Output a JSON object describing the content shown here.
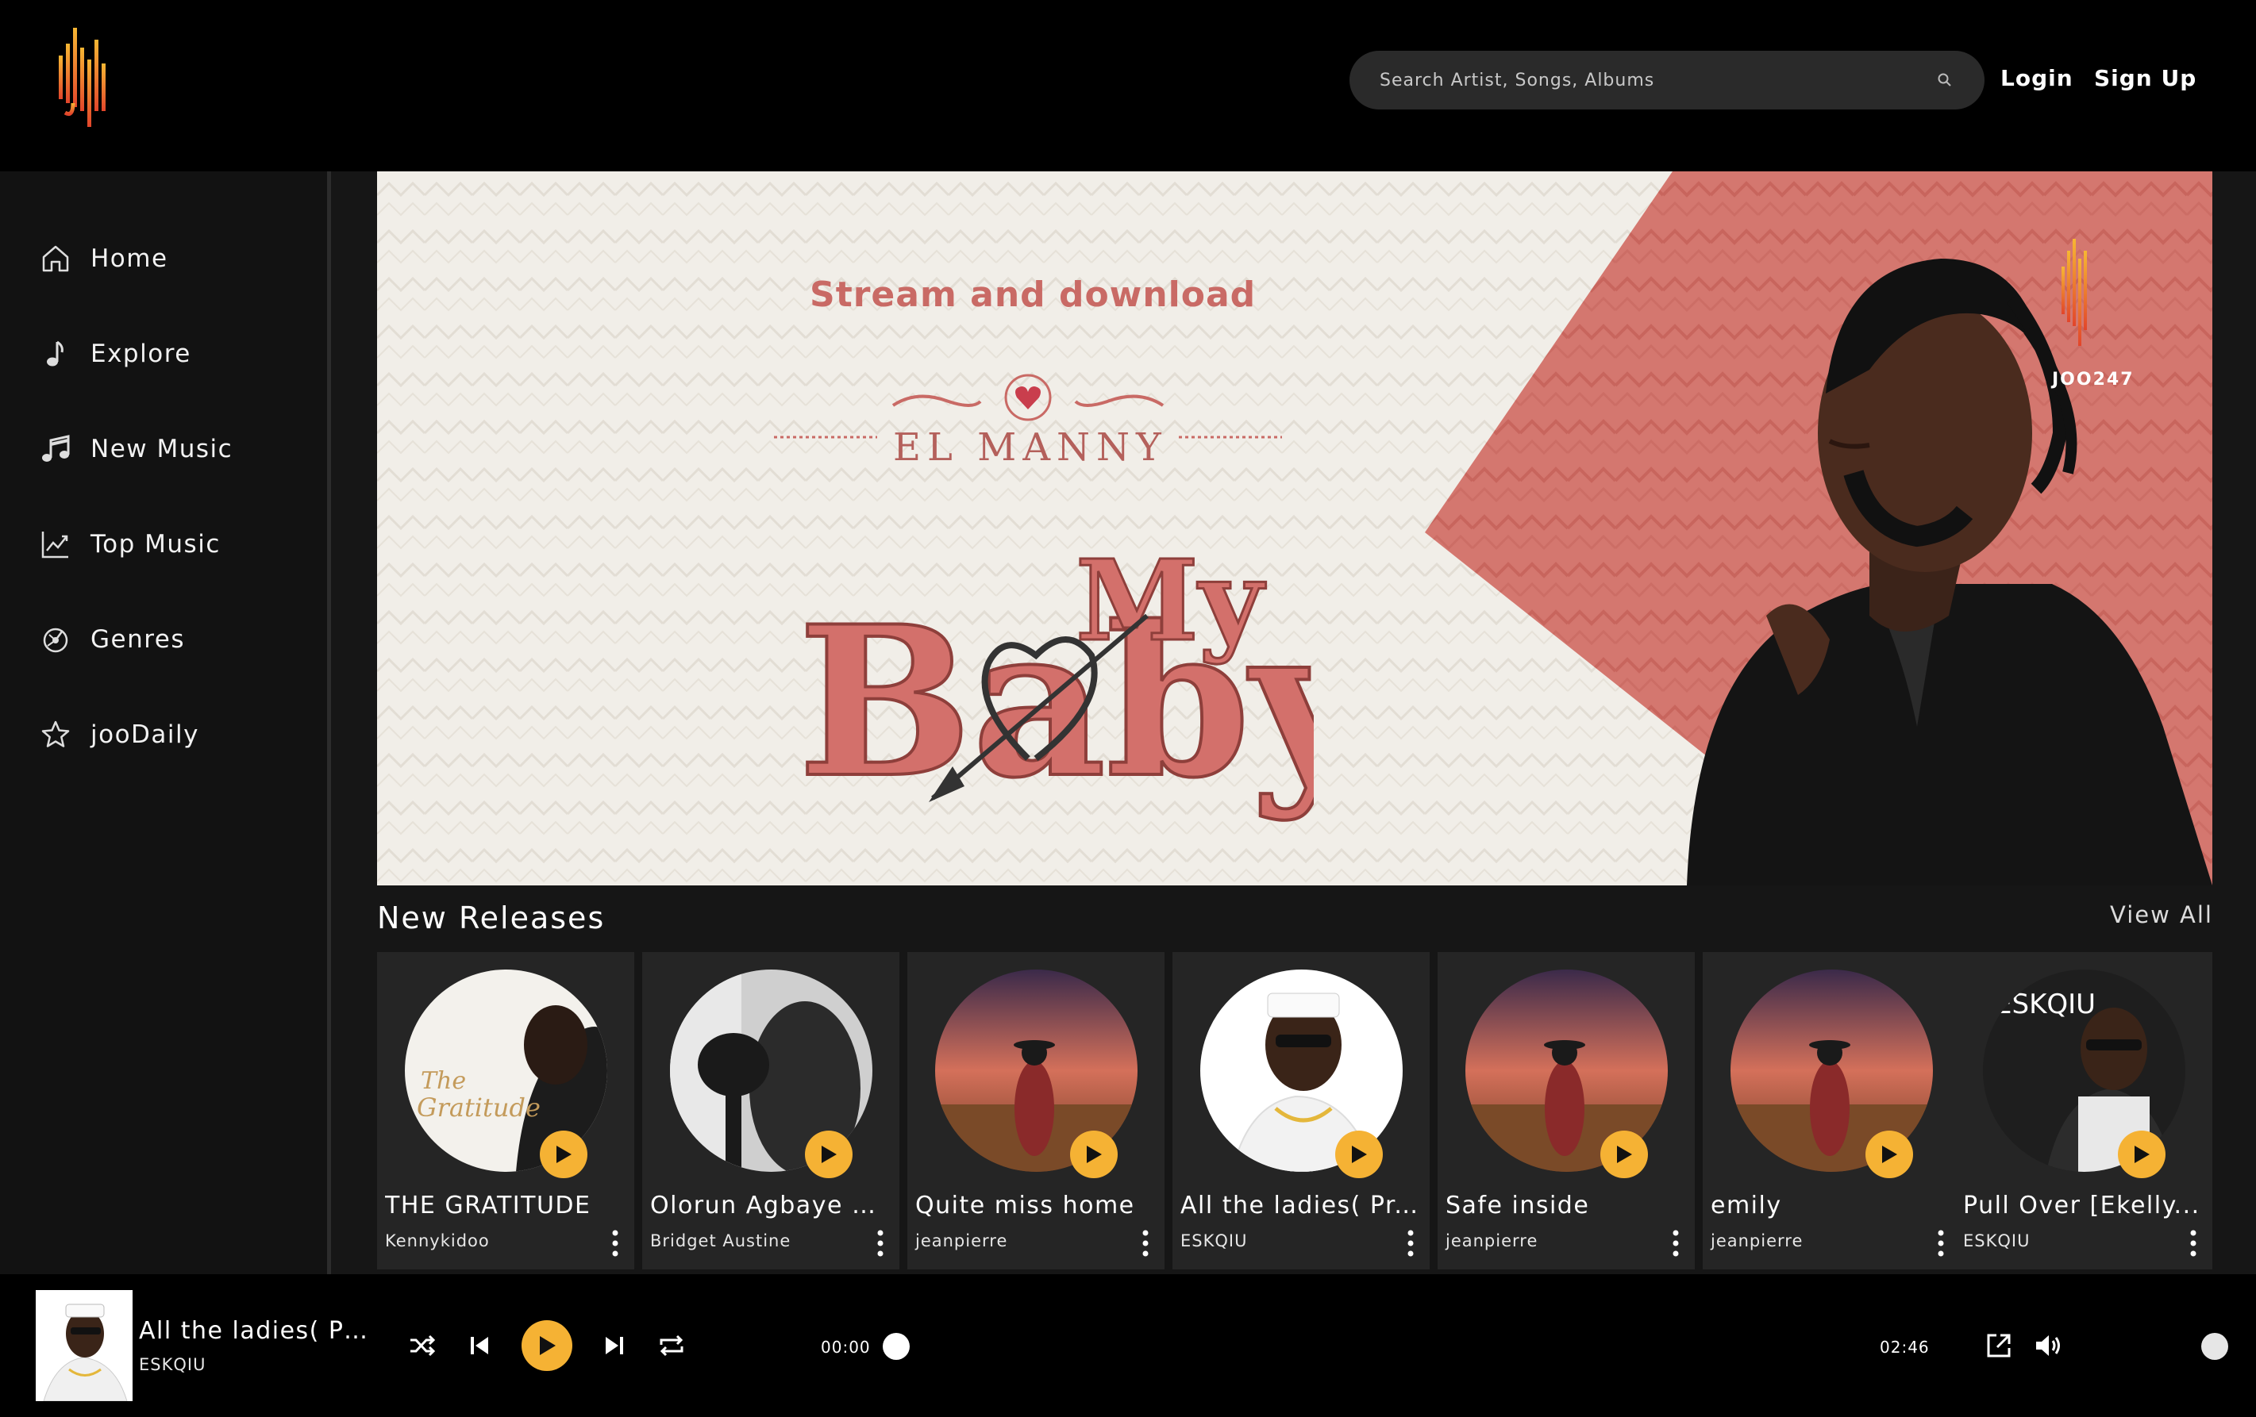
{
  "header": {
    "search_placeholder": "Search Artist, Songs, Albums",
    "login_label": "Login",
    "signup_label": "Sign Up"
  },
  "sidebar": {
    "items": [
      {
        "label": "Home",
        "icon": "home-icon"
      },
      {
        "label": "Explore",
        "icon": "music-note-icon"
      },
      {
        "label": "New Music",
        "icon": "music-notes-icon"
      },
      {
        "label": "Top Music",
        "icon": "trending-chart-icon"
      },
      {
        "label": "Genres",
        "icon": "genres-icon"
      },
      {
        "label": "jooDaily",
        "icon": "star-icon"
      }
    ]
  },
  "banner": {
    "stream_text": "Stream  and download",
    "artist_name": "EL MANNY",
    "song_title": "My Baby",
    "brand": "JOO247"
  },
  "new_releases": {
    "title": "New Releases",
    "view_all_label": "View All",
    "items": [
      {
        "title": "THE GRATITUDE",
        "artist": "Kennykidoo"
      },
      {
        "title": "Olorun Agbaye C...",
        "artist": "Bridget Austine"
      },
      {
        "title": "Quite miss home",
        "artist": "jeanpierre"
      },
      {
        "title": "All the ladies( Pr...",
        "artist": "ESKQIU"
      },
      {
        "title": "Safe inside",
        "artist": "jeanpierre"
      },
      {
        "title": "emily",
        "artist": "jeanpierre"
      },
      {
        "title": "Pull Over [Ekelly...",
        "artist": "ESKQIU"
      }
    ]
  },
  "player": {
    "title": "All the ladies( Pr...",
    "artist": "ESKQIU",
    "current_time": "00:00",
    "duration": "02:46",
    "progress": 0
  },
  "colors": {
    "accent": "#f5b234",
    "banner_pink": "#c96a65",
    "sidebar_bg": "#121212",
    "card_bg": "#252525"
  }
}
